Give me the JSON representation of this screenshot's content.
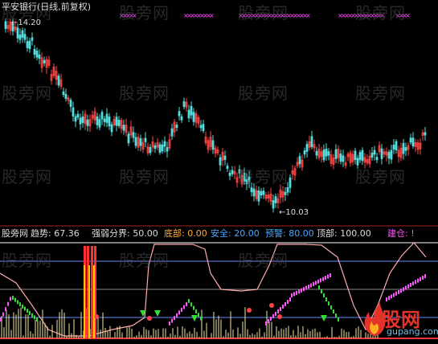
{
  "title": "平安银行(日线,前复权)",
  "price_high_label": "14.20",
  "price_low_label": "10.03",
  "indicator": [
    {
      "label": "股旁网",
      "color": "#dddddd"
    },
    {
      "label": "趋势: 67.36",
      "color": "#dddddd"
    },
    {
      "label": "强弱分界: 50.00",
      "color": "#dddddd"
    },
    {
      "label": "底部: 0.00",
      "color": "#ffaa44"
    },
    {
      "label": "安全: 20.00",
      "color": "#4aa8ff"
    },
    {
      "label": "预警: 80.00",
      "color": "#4aa8ff"
    },
    {
      "label": "顶部: 100.00",
      "color": "#dddddd"
    },
    {
      "label": "建仓: !",
      "color": "#ff55ff"
    }
  ],
  "watermark_text": "股旁网",
  "logo": {
    "big": "股网",
    "small": "gupang.com"
  },
  "colors": {
    "up": "#ff4444",
    "down": "#55dddd",
    "magenta": "#ff55ff"
  }
}
